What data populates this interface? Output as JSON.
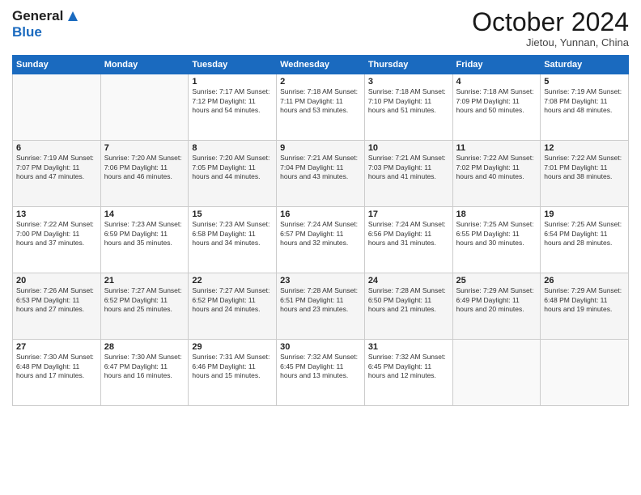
{
  "header": {
    "logo_line1": "General",
    "logo_line2": "Blue",
    "month_title": "October 2024",
    "location": "Jietou, Yunnan, China"
  },
  "weekdays": [
    "Sunday",
    "Monday",
    "Tuesday",
    "Wednesday",
    "Thursday",
    "Friday",
    "Saturday"
  ],
  "weeks": [
    [
      {
        "day": "",
        "info": ""
      },
      {
        "day": "",
        "info": ""
      },
      {
        "day": "1",
        "info": "Sunrise: 7:17 AM\nSunset: 7:12 PM\nDaylight: 11 hours and 54 minutes."
      },
      {
        "day": "2",
        "info": "Sunrise: 7:18 AM\nSunset: 7:11 PM\nDaylight: 11 hours and 53 minutes."
      },
      {
        "day": "3",
        "info": "Sunrise: 7:18 AM\nSunset: 7:10 PM\nDaylight: 11 hours and 51 minutes."
      },
      {
        "day": "4",
        "info": "Sunrise: 7:18 AM\nSunset: 7:09 PM\nDaylight: 11 hours and 50 minutes."
      },
      {
        "day": "5",
        "info": "Sunrise: 7:19 AM\nSunset: 7:08 PM\nDaylight: 11 hours and 48 minutes."
      }
    ],
    [
      {
        "day": "6",
        "info": "Sunrise: 7:19 AM\nSunset: 7:07 PM\nDaylight: 11 hours and 47 minutes."
      },
      {
        "day": "7",
        "info": "Sunrise: 7:20 AM\nSunset: 7:06 PM\nDaylight: 11 hours and 46 minutes."
      },
      {
        "day": "8",
        "info": "Sunrise: 7:20 AM\nSunset: 7:05 PM\nDaylight: 11 hours and 44 minutes."
      },
      {
        "day": "9",
        "info": "Sunrise: 7:21 AM\nSunset: 7:04 PM\nDaylight: 11 hours and 43 minutes."
      },
      {
        "day": "10",
        "info": "Sunrise: 7:21 AM\nSunset: 7:03 PM\nDaylight: 11 hours and 41 minutes."
      },
      {
        "day": "11",
        "info": "Sunrise: 7:22 AM\nSunset: 7:02 PM\nDaylight: 11 hours and 40 minutes."
      },
      {
        "day": "12",
        "info": "Sunrise: 7:22 AM\nSunset: 7:01 PM\nDaylight: 11 hours and 38 minutes."
      }
    ],
    [
      {
        "day": "13",
        "info": "Sunrise: 7:22 AM\nSunset: 7:00 PM\nDaylight: 11 hours and 37 minutes."
      },
      {
        "day": "14",
        "info": "Sunrise: 7:23 AM\nSunset: 6:59 PM\nDaylight: 11 hours and 35 minutes."
      },
      {
        "day": "15",
        "info": "Sunrise: 7:23 AM\nSunset: 6:58 PM\nDaylight: 11 hours and 34 minutes."
      },
      {
        "day": "16",
        "info": "Sunrise: 7:24 AM\nSunset: 6:57 PM\nDaylight: 11 hours and 32 minutes."
      },
      {
        "day": "17",
        "info": "Sunrise: 7:24 AM\nSunset: 6:56 PM\nDaylight: 11 hours and 31 minutes."
      },
      {
        "day": "18",
        "info": "Sunrise: 7:25 AM\nSunset: 6:55 PM\nDaylight: 11 hours and 30 minutes."
      },
      {
        "day": "19",
        "info": "Sunrise: 7:25 AM\nSunset: 6:54 PM\nDaylight: 11 hours and 28 minutes."
      }
    ],
    [
      {
        "day": "20",
        "info": "Sunrise: 7:26 AM\nSunset: 6:53 PM\nDaylight: 11 hours and 27 minutes."
      },
      {
        "day": "21",
        "info": "Sunrise: 7:27 AM\nSunset: 6:52 PM\nDaylight: 11 hours and 25 minutes."
      },
      {
        "day": "22",
        "info": "Sunrise: 7:27 AM\nSunset: 6:52 PM\nDaylight: 11 hours and 24 minutes."
      },
      {
        "day": "23",
        "info": "Sunrise: 7:28 AM\nSunset: 6:51 PM\nDaylight: 11 hours and 23 minutes."
      },
      {
        "day": "24",
        "info": "Sunrise: 7:28 AM\nSunset: 6:50 PM\nDaylight: 11 hours and 21 minutes."
      },
      {
        "day": "25",
        "info": "Sunrise: 7:29 AM\nSunset: 6:49 PM\nDaylight: 11 hours and 20 minutes."
      },
      {
        "day": "26",
        "info": "Sunrise: 7:29 AM\nSunset: 6:48 PM\nDaylight: 11 hours and 19 minutes."
      }
    ],
    [
      {
        "day": "27",
        "info": "Sunrise: 7:30 AM\nSunset: 6:48 PM\nDaylight: 11 hours and 17 minutes."
      },
      {
        "day": "28",
        "info": "Sunrise: 7:30 AM\nSunset: 6:47 PM\nDaylight: 11 hours and 16 minutes."
      },
      {
        "day": "29",
        "info": "Sunrise: 7:31 AM\nSunset: 6:46 PM\nDaylight: 11 hours and 15 minutes."
      },
      {
        "day": "30",
        "info": "Sunrise: 7:32 AM\nSunset: 6:45 PM\nDaylight: 11 hours and 13 minutes."
      },
      {
        "day": "31",
        "info": "Sunrise: 7:32 AM\nSunset: 6:45 PM\nDaylight: 11 hours and 12 minutes."
      },
      {
        "day": "",
        "info": ""
      },
      {
        "day": "",
        "info": ""
      }
    ]
  ]
}
